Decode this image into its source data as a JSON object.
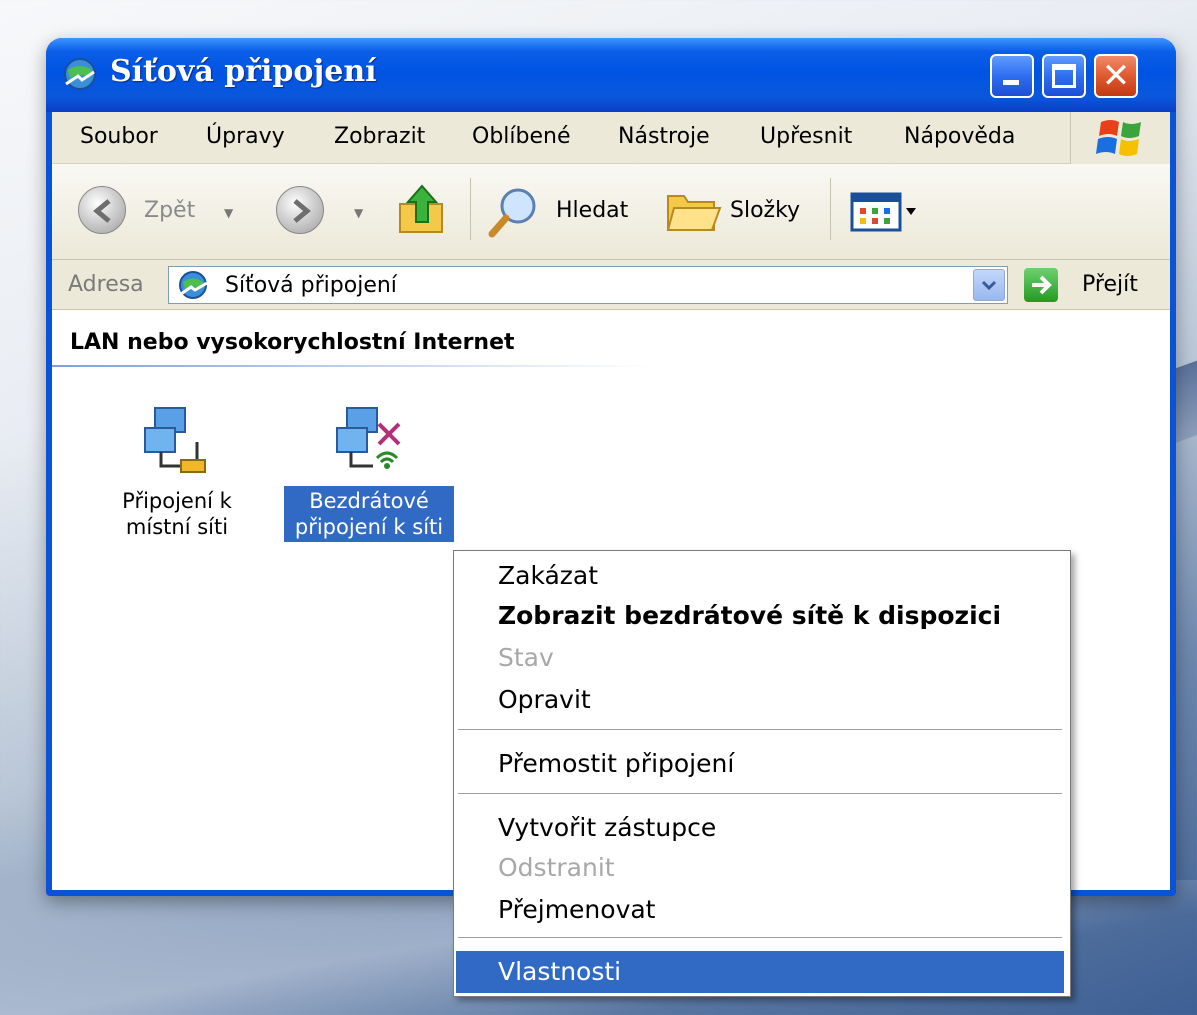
{
  "window": {
    "title": "Síťová připojení"
  },
  "menubar": {
    "items": [
      "Soubor",
      "Úpravy",
      "Zobrazit",
      "Oblíbené",
      "Nástroje",
      "Upřesnit",
      "Nápověda"
    ]
  },
  "toolbar": {
    "back_label": "Zpět",
    "search_label": "Hledat",
    "folders_label": "Složky"
  },
  "addressbar": {
    "label": "Adresa",
    "value": "Síťová připojení",
    "go_label": "Přejít"
  },
  "content": {
    "group_title": "LAN nebo vysokorychlostní Internet",
    "icons": [
      {
        "line1": "Připojení k",
        "line2": "místní síti",
        "selected": false
      },
      {
        "line1": "Bezdrátové",
        "line2": "připojení k síti",
        "selected": true
      }
    ]
  },
  "context_menu": {
    "items": [
      {
        "label": "Zakázat",
        "state": "normal"
      },
      {
        "label": "Zobrazit bezdrátové sítě k dispozici",
        "state": "bold"
      },
      {
        "label": "Stav",
        "state": "disabled"
      },
      {
        "label": "Opravit",
        "state": "normal"
      },
      {
        "label": "Přemostit připojení",
        "state": "normal"
      },
      {
        "label": "Vytvořit zástupce",
        "state": "normal"
      },
      {
        "label": "Odstranit",
        "state": "disabled"
      },
      {
        "label": "Přejmenovat",
        "state": "normal"
      },
      {
        "label": "Vlastnosti",
        "state": "highlighted"
      }
    ]
  },
  "colors": {
    "titlebar": "#0054e3",
    "selection": "#316ac5",
    "chrome": "#ece9d8"
  }
}
